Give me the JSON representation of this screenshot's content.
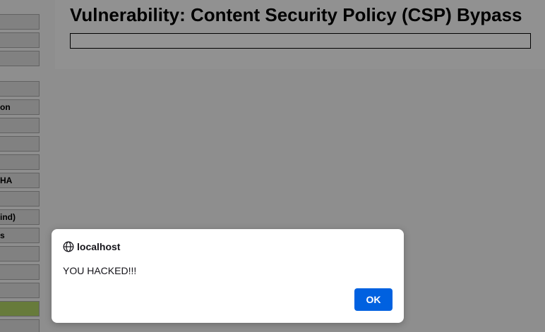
{
  "sidebar": {
    "items": [
      {
        "label": "",
        "selected": false
      },
      {
        "label": "",
        "selected": false
      },
      {
        "label": "",
        "selected": false
      },
      {
        "label": "",
        "selected": false
      },
      {
        "label": "on",
        "selected": false
      },
      {
        "label": "",
        "selected": false
      },
      {
        "label": "",
        "selected": false
      },
      {
        "label": "",
        "selected": false
      },
      {
        "label": "HA",
        "selected": false
      },
      {
        "label": "",
        "selected": false
      },
      {
        "label": "ind)",
        "selected": false
      },
      {
        "label": "s",
        "selected": false
      },
      {
        "label": "",
        "selected": false
      },
      {
        "label": "",
        "selected": false
      },
      {
        "label": "",
        "selected": false
      },
      {
        "label": "",
        "selected": true
      },
      {
        "label": "",
        "selected": false
      }
    ]
  },
  "main": {
    "title": "Vulnerability: Content Security Policy (CSP) Bypass"
  },
  "dialog": {
    "origin": "localhost",
    "message": "YOU HACKED!!!",
    "ok_label": "OK"
  },
  "colors": {
    "ok_button": "#0061e0",
    "selected_menu": "#b2d466",
    "overlay": "rgba(0,0,0,0.42)"
  }
}
